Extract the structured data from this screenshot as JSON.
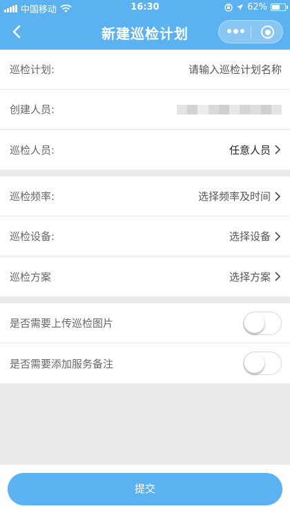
{
  "status_bar": {
    "carrier": "中国移动",
    "time": "16:30",
    "battery_text": "62%",
    "battery_level": 0.62,
    "icons": [
      "signal-icon",
      "wifi-icon",
      "orientation-lock-icon",
      "location-icon",
      "battery-icon"
    ]
  },
  "navbar": {
    "title": "新建巡检计划",
    "back_icon": "chevron-left-icon",
    "more_icon": "more-dots-icon",
    "close_icon": "circle-target-icon"
  },
  "form": {
    "group1": [
      {
        "label": "巡检计划:",
        "value": "请输入巡检计划名称",
        "type": "input"
      },
      {
        "label": "创建人员:",
        "value": "",
        "type": "blurred"
      },
      {
        "label": "巡检人员:",
        "value": "任意人员",
        "type": "select"
      }
    ],
    "group2": [
      {
        "label": "巡检频率:",
        "value": "选择频率及时间",
        "type": "select"
      },
      {
        "label": "巡检设备:",
        "value": "选择设备",
        "type": "select"
      },
      {
        "label": "巡检方案",
        "value": "选择方案",
        "type": "select"
      }
    ],
    "group3": [
      {
        "label": "是否需要上传巡检图片",
        "type": "switch",
        "on": false
      },
      {
        "label": "是否需要添加服务备注",
        "type": "switch",
        "on": false
      }
    ]
  },
  "footer": {
    "submit_label": "提交"
  },
  "colors": {
    "brand": "#5bb2f0",
    "background": "#ebebeb"
  }
}
